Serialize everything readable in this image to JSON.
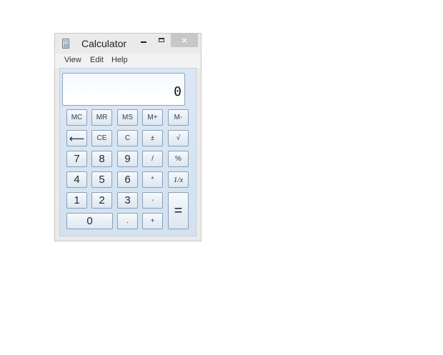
{
  "window": {
    "title": "Calculator",
    "icon": "calculator-icon",
    "controls": {
      "minimize": "minimize-icon",
      "maximize": "maximize-icon",
      "close_label": "✕"
    }
  },
  "menu": [
    "View",
    "Edit",
    "Help"
  ],
  "display": {
    "value": "0"
  },
  "keys": {
    "mc": "MC",
    "mr": "MR",
    "ms": "MS",
    "mplus": "M+",
    "mminus": "M-",
    "backspace": "⟵",
    "ce": "CE",
    "c": "C",
    "negate": "±",
    "sqrt": "√",
    "seven": "7",
    "eight": "8",
    "nine": "9",
    "divide": "/",
    "percent": "%",
    "four": "4",
    "five": "5",
    "six": "6",
    "multiply": "*",
    "reciprocal": "1/x",
    "one": "1",
    "two": "2",
    "three": "3",
    "subtract": "-",
    "equals": "=",
    "zero": "0",
    "decimal": ".",
    "add": "+"
  },
  "colors": {
    "window_frame": "#eaeaea",
    "client_bg": "#d3e1f0",
    "key_border": "#8b9fb6",
    "close_button": "#c7c7c7"
  }
}
